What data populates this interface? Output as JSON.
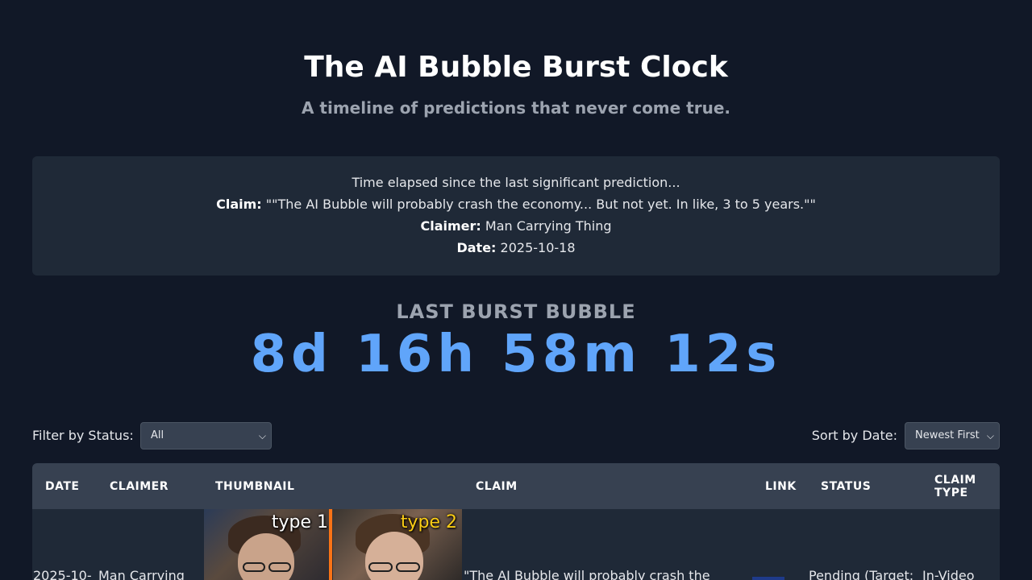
{
  "header": {
    "title": "The AI Bubble Burst Clock",
    "subtitle": "A timeline of predictions that never come true."
  },
  "info": {
    "intro": "Time elapsed since the last significant prediction...",
    "claim_label": "Claim:",
    "claim_value": "\"\"The AI Bubble will probably crash the economy... But not yet. In like, 3 to 5 years.\"\"",
    "claimer_label": "Claimer:",
    "claimer_value": "Man Carrying Thing",
    "date_label": "Date:",
    "date_value": "2025-10-18"
  },
  "countdown": {
    "label": "LAST BURST BUBBLE",
    "value": "8d 16h 58m 12s"
  },
  "controls": {
    "filter_label": "Filter by Status:",
    "filter_selected": "All",
    "sort_label": "Sort by Date:",
    "sort_selected": "Newest First"
  },
  "table": {
    "headers": {
      "date": "DATE",
      "claimer": "CLAIMER",
      "thumbnail": "THUMBNAIL",
      "claim": "CLAIM",
      "link": "LINK",
      "status": "STATUS",
      "claim_type_1": "CLAIM",
      "claim_type_2": "TYPE"
    },
    "rows": [
      {
        "date": "2025-10-",
        "claimer": "Man Carrying",
        "thumb_tag_1": "type 1",
        "thumb_tag_2": "type 2",
        "claim": "\"The AI Bubble will probably crash the",
        "status": "Pending (Target:",
        "claim_type": "In-Video"
      }
    ]
  },
  "colors": {
    "background": "#111827",
    "card": "#1f2937",
    "header_row": "#374151",
    "accent": "#60a5fa",
    "muted": "#9ca3af"
  }
}
